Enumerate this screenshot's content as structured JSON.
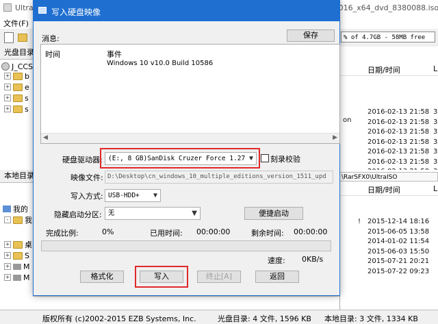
{
  "main_window": {
    "title": "UltraISO - D:\\Desktop\\cn_windows_10_multiple_editions_version_1511_updated_feb_2016_x64_dvd_8380088.iso",
    "menu_file": "文件(F)",
    "size_bar_text": "% of 4.7GB - 58MB free",
    "cd_dir_header": "光盘目录",
    "cd_root": "J_CCS",
    "tree_folders": [
      "b",
      "e",
      "s",
      "s"
    ],
    "local_dir_header": "本地目录",
    "local_tree": [
      "我的",
      "我",
      "桌",
      "S",
      "M",
      "M"
    ],
    "right_top_header": "日期/时间",
    "right_top_header_extra": "L",
    "right_top_rows": [
      {
        "dt": "2016-02-13 21:58",
        "c": "3"
      },
      {
        "dt": "2016-02-13 21:58",
        "c": "3"
      },
      {
        "dt": "2016-02-13 21:58",
        "c": "3"
      },
      {
        "dt": "2016-02-13 21:58",
        "c": "3"
      },
      {
        "dt": "2016-02-13 21:58",
        "c": "3"
      },
      {
        "dt": "2016-02-13 21:58",
        "c": "3"
      },
      {
        "dt": "2016-02-13 21:58",
        "c": "3"
      },
      {
        "dt": "2016-02-13 21:58",
        "c": "3"
      }
    ],
    "right_top_fragment": "on",
    "path_bar": "\\RarSFX0\\UltraISO",
    "right_bot_header": "日期/时间",
    "right_bot_header_extra": "L",
    "right_bot_rows": [
      {
        "dt": "2015-12-14 18:16",
        "m": "!"
      },
      {
        "dt": "2015-06-05 13:58",
        "m": ""
      },
      {
        "dt": "2014-01-02 11:54",
        "m": ""
      },
      {
        "dt": "2015-06-03 15:50",
        "m": ""
      },
      {
        "dt": "2015-07-21 20:21",
        "m": ""
      },
      {
        "dt": "2015-07-22 09:23",
        "m": ""
      }
    ],
    "status_copyright": "版权所有 (c)2002-2015 EZB Systems, Inc.",
    "status_cd": "光盘目录: 4 文件, 1596 KB",
    "status_local": "本地目录: 3 文件, 1334 KB"
  },
  "dialog": {
    "title": "写入硬盘映像",
    "message_label": "消息:",
    "save_button": "保存",
    "log_header_time": "时间",
    "log_header_event": "事件",
    "log_rows": [
      {
        "time": "",
        "event": "Windows 10 v10.0 Build 10586"
      }
    ],
    "drive_label": "硬盘驱动器:",
    "drive_value": "(E:, 8 GB)SanDisk Cruzer Force    1.27",
    "verify_label": "刻录校验",
    "verify_checked": false,
    "image_label": "映像文件:",
    "image_value": "D:\\Desktop\\cn_windows_10_multiple_editions_version_1511_upd",
    "write_method_label": "写入方式:",
    "write_method_value": "USB-HDD+",
    "hidden_partition_label": "隐藏启动分区:",
    "hidden_partition_value": "无",
    "boot_button": "便捷启动",
    "progress_label": "完成比例:",
    "progress_value": "0%",
    "progress_fraction": 0,
    "elapsed_label": "已用时间:",
    "elapsed_value": "00:00:00",
    "remaining_label": "剩余时间:",
    "remaining_value": "00:00:00",
    "speed_label": "速度:",
    "speed_value": "0KB/s",
    "format_button": "格式化",
    "write_button": "写入",
    "abort_button": "终止[A]",
    "back_button": "返回"
  },
  "colors": {
    "dialog_title_bg": "#1e6fd0",
    "highlight_red": "#e0282a",
    "progress_fill": "#06b025"
  }
}
